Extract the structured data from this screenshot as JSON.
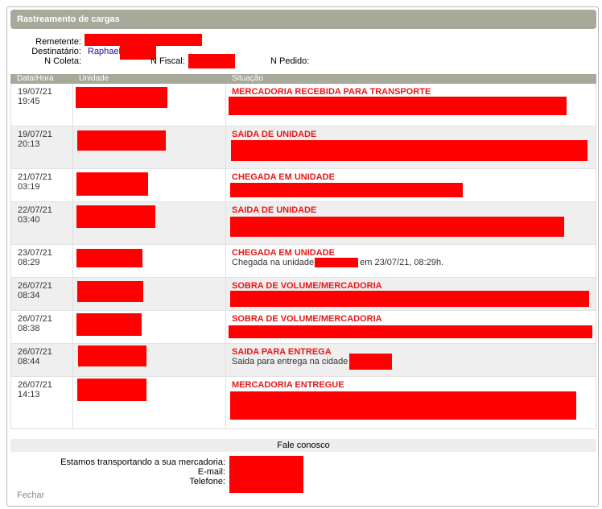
{
  "title": "Rastreamento de cargas",
  "info": {
    "remetente_label": "Remetente:",
    "destinatario_label": "Destinatário:",
    "destinatario_value": "Raphael",
    "coleta_label": "N Coleta:",
    "fiscal_label": "N Fiscal:",
    "pedido_label": "N Pedido:"
  },
  "table": {
    "headers": [
      "Data/Hora",
      "Unidade",
      "Situação"
    ],
    "rows": [
      {
        "date": "19/07/21",
        "time": "19:45",
        "status": "MERCADORIA RECEBIDA PARA TRANSPORTE",
        "desc": ""
      },
      {
        "date": "19/07/21",
        "time": "20:13",
        "status": "SAIDA DE UNIDADE",
        "desc": ""
      },
      {
        "date": "21/07/21",
        "time": "03:19",
        "status": "CHEGADA EM UNIDADE",
        "desc": ""
      },
      {
        "date": "22/07/21",
        "time": "03:40",
        "status": "SAIDA DE UNIDADE",
        "desc": ""
      },
      {
        "date": "23/07/21",
        "time": "08:29",
        "status": "CHEGADA EM UNIDADE",
        "desc_pre": "Chegada na unidade",
        "desc_post": "em 23/07/21, 08:29h."
      },
      {
        "date": "26/07/21",
        "time": "08:34",
        "status": "SOBRA DE VOLUME/MERCADORIA",
        "desc": ""
      },
      {
        "date": "26/07/21",
        "time": "08:38",
        "status": "SOBRA DE VOLUME/MERCADORIA",
        "desc": ""
      },
      {
        "date": "26/07/21",
        "time": "08:44",
        "status": "SAIDA PARA ENTREGA",
        "desc_pre": "Saida para entrega na cidade",
        "desc_post": ""
      },
      {
        "date": "26/07/21",
        "time": "14:13",
        "status": "MERCADORIA ENTREGUE",
        "desc": ""
      }
    ]
  },
  "footer": {
    "contact_link": "Fale conosco",
    "transport_label": "Estamos transportando a sua mercadoria:",
    "email_label": "E-mail:",
    "phone_label": "Telefone:",
    "close_label": "Fechar"
  },
  "colors": {
    "header_bg": "#a7a99b",
    "status_red": "#e81818",
    "redaction": "#ff0000"
  }
}
